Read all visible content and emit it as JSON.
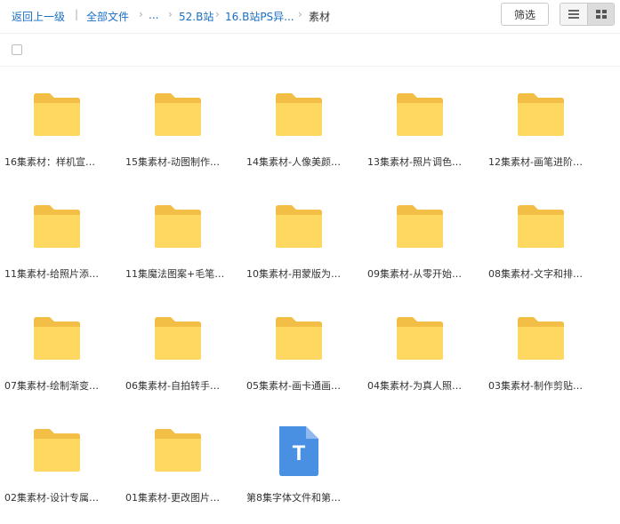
{
  "breadcrumb": {
    "back": "返回上一级",
    "all_files": "全部文件",
    "ellipsis": "...",
    "level1": "52.B站",
    "level2": "16.B站PS异...",
    "current": "素材"
  },
  "toolbar": {
    "filter_label": "筛选",
    "active_view": "grid"
  },
  "files": [
    {
      "name": "16集素材：样机宣…",
      "type": "folder"
    },
    {
      "name": "15集素材-动图制作…",
      "type": "folder"
    },
    {
      "name": "14集素材-人像美颜…",
      "type": "folder"
    },
    {
      "name": "13集素材-照片调色…",
      "type": "folder"
    },
    {
      "name": "12集素材-画笔进阶…",
      "type": "folder"
    },
    {
      "name": "11集素材-给照片添…",
      "type": "folder"
    },
    {
      "name": "11集魔法图案+毛笔…",
      "type": "folder"
    },
    {
      "name": "10集素材-用蒙版为…",
      "type": "folder"
    },
    {
      "name": "09集素材-从零开始…",
      "type": "folder"
    },
    {
      "name": "08集素材-文字和排…",
      "type": "folder"
    },
    {
      "name": "07集素材-绘制渐变…",
      "type": "folder"
    },
    {
      "name": "06集素材-自拍转手…",
      "type": "folder"
    },
    {
      "name": "05集素材-画卡通画…",
      "type": "folder"
    },
    {
      "name": "04集素材-为真人照…",
      "type": "folder"
    },
    {
      "name": "03集素材-制作剪贴…",
      "type": "folder"
    },
    {
      "name": "02集素材-设计专属…",
      "type": "folder"
    },
    {
      "name": "01集素材-更改图片…",
      "type": "folder"
    },
    {
      "name": "第8集字体文件和第…",
      "type": "text",
      "badge": "T"
    }
  ],
  "colors": {
    "folder_back": "#f2be45",
    "folder_front": "#ffd862",
    "text_file": "#4a90e2",
    "link": "#1a6fc4"
  }
}
